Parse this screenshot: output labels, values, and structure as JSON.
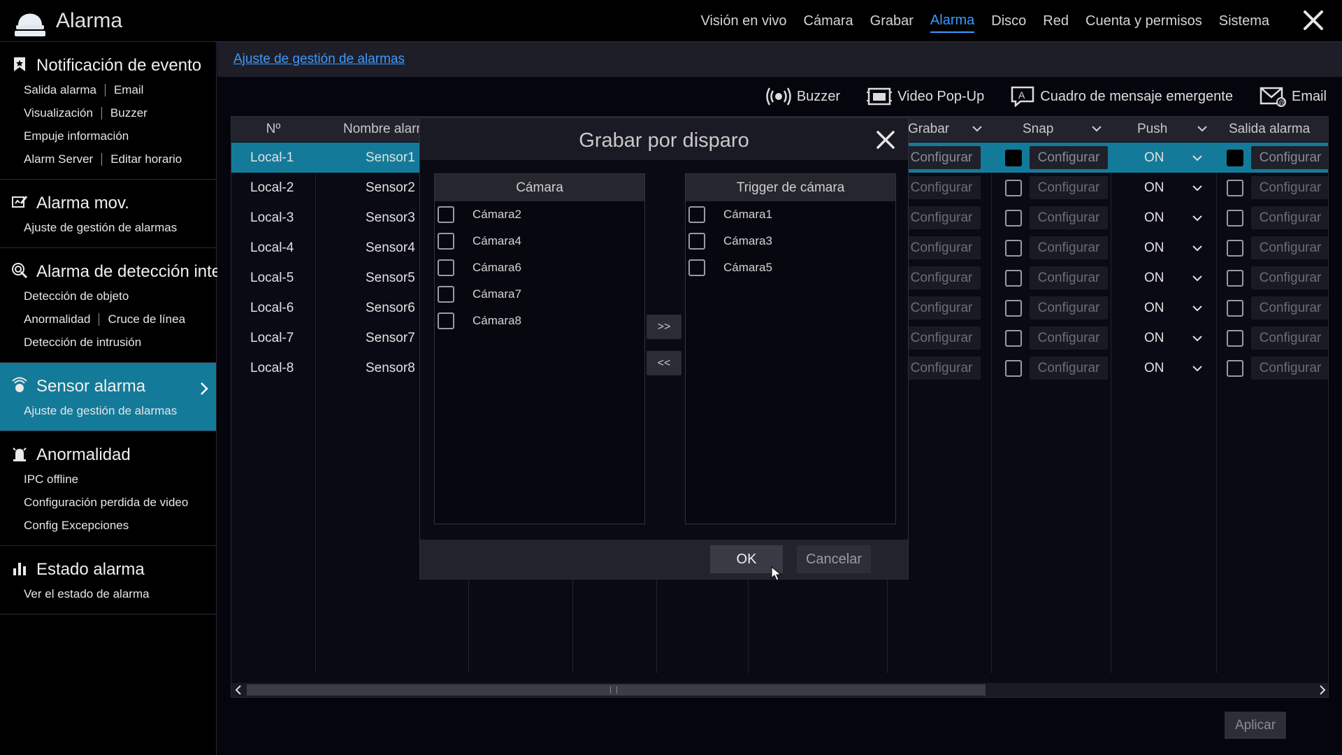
{
  "app": {
    "title": "Alarma"
  },
  "topnav": [
    {
      "label": "Visión en vivo",
      "active": false
    },
    {
      "label": "Cámara",
      "active": false
    },
    {
      "label": "Grabar",
      "active": false
    },
    {
      "label": "Alarma",
      "active": true
    },
    {
      "label": "Disco",
      "active": false
    },
    {
      "label": "Red",
      "active": false
    },
    {
      "label": "Cuenta y permisos",
      "active": false
    },
    {
      "label": "Sistema",
      "active": false
    }
  ],
  "sidebar": {
    "sections": [
      {
        "title": "Notificación de evento",
        "icon": "bookmark-icon",
        "rows": [
          [
            "Salida alarma",
            "Email"
          ],
          [
            "Visualización",
            "Buzzer"
          ],
          [
            "Empuje información"
          ],
          [
            "Alarm Server",
            "Editar horario"
          ]
        ]
      },
      {
        "title": "Alarma mov.",
        "icon": "motion-edit-icon",
        "rows": [
          [
            "Ajuste de gestión de alarmas"
          ]
        ]
      },
      {
        "title": "Alarma de detección inteligente",
        "icon": "smart-detection-icon",
        "rows": [
          [
            "Detección de objeto"
          ],
          [
            "Anormalidad",
            "Cruce de línea"
          ],
          [
            "Detección de intrusión"
          ]
        ]
      },
      {
        "title": "Sensor alarma",
        "icon": "sensor-icon",
        "active": true,
        "rows": [
          [
            "Ajuste de gestión de alarmas"
          ]
        ]
      },
      {
        "title": "Anormalidad",
        "icon": "alarm-bell-icon",
        "rows": [
          [
            "IPC offline"
          ],
          [
            "Configuración perdida de video"
          ],
          [
            "Config Excepciones"
          ]
        ]
      },
      {
        "title": "Estado alarma",
        "icon": "status-chart-icon",
        "rows": [
          [
            "Ver el estado de alarma"
          ]
        ]
      }
    ]
  },
  "breadcrumb": "Ajuste de gestión de alarmas",
  "toolbar": {
    "buzzer": "Buzzer",
    "popup_video": "Video Pop-Up",
    "popup_message": "Cuadro de mensaje emergente",
    "email": "Email"
  },
  "table": {
    "headers": {
      "no": "Nº",
      "name": "Nombre alarma",
      "record": "Grabar",
      "snap": "Snap",
      "push": "Push",
      "output": "Salida alarma"
    },
    "config_label": "Configurar",
    "rows": [
      {
        "no": "Local-1",
        "name": "Sensor1",
        "push": "ON"
      },
      {
        "no": "Local-2",
        "name": "Sensor2",
        "push": "ON"
      },
      {
        "no": "Local-3",
        "name": "Sensor3",
        "push": "ON"
      },
      {
        "no": "Local-4",
        "name": "Sensor4",
        "push": "ON"
      },
      {
        "no": "Local-5",
        "name": "Sensor5",
        "push": "ON"
      },
      {
        "no": "Local-6",
        "name": "Sensor6",
        "push": "ON"
      },
      {
        "no": "Local-7",
        "name": "Sensor7",
        "push": "ON"
      },
      {
        "no": "Local-8",
        "name": "Sensor8",
        "push": "ON"
      }
    ]
  },
  "apply_label": "Aplicar",
  "modal": {
    "title": "Grabar por disparo",
    "left_header": "Cámara",
    "left_items": [
      "Cámara2",
      "Cámara4",
      "Cámara6",
      "Cámara7",
      "Cámara8"
    ],
    "right_header": "Trigger de cámara",
    "right_items": [
      "Cámara1",
      "Cámara3",
      "Cámara5"
    ],
    "move_right": ">>",
    "move_left": "<<",
    "ok": "OK",
    "cancel": "Cancelar"
  },
  "colors": {
    "accent": "#3a9bff",
    "selection": "#147a99",
    "background": "#06060f"
  }
}
